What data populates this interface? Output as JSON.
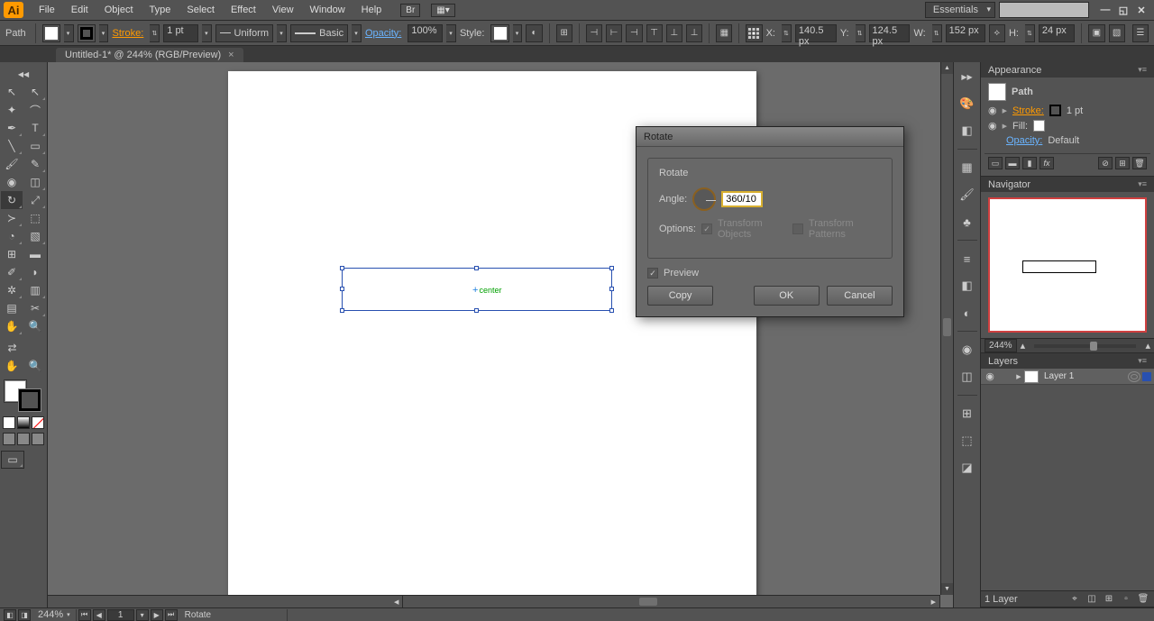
{
  "menu": {
    "items": [
      "File",
      "Edit",
      "Object",
      "Type",
      "Select",
      "Effect",
      "View",
      "Window",
      "Help"
    ],
    "workspace": "Essentials",
    "bridge": "Br"
  },
  "control": {
    "selection_label": "Path",
    "stroke_label": "Stroke:",
    "stroke_weight": "1 pt",
    "stroke_profile": "Uniform",
    "brush": "Basic",
    "opacity_label": "Opacity:",
    "opacity": "100%",
    "style_label": "Style:",
    "x_label": "X:",
    "x": "140.5 px",
    "y_label": "Y:",
    "y": "124.5 px",
    "w_label": "W:",
    "w": "152 px",
    "h_label": "H:",
    "h": "24 px"
  },
  "tab": {
    "title": "Untitled-1* @ 244% (RGB/Preview)"
  },
  "canvas": {
    "center_label": "center"
  },
  "dialog": {
    "title": "Rotate",
    "group": "Rotate",
    "angle_label": "Angle:",
    "angle_value": "360/10",
    "options_label": "Options:",
    "transform_objects": "Transform Objects",
    "transform_patterns": "Transform Patterns",
    "preview": "Preview",
    "copy": "Copy",
    "ok": "OK",
    "cancel": "Cancel"
  },
  "appearance": {
    "tab": "Appearance",
    "path": "Path",
    "stroke": "Stroke:",
    "stroke_val": "1 pt",
    "fill": "Fill:",
    "opacity": "Opacity:",
    "opacity_val": "Default"
  },
  "navigator": {
    "tab": "Navigator",
    "zoom": "244%"
  },
  "layers": {
    "tab": "Layers",
    "layer1": "Layer 1",
    "footer": "1 Layer"
  },
  "status": {
    "zoom": "244%",
    "page": "1",
    "tool": "Rotate"
  }
}
